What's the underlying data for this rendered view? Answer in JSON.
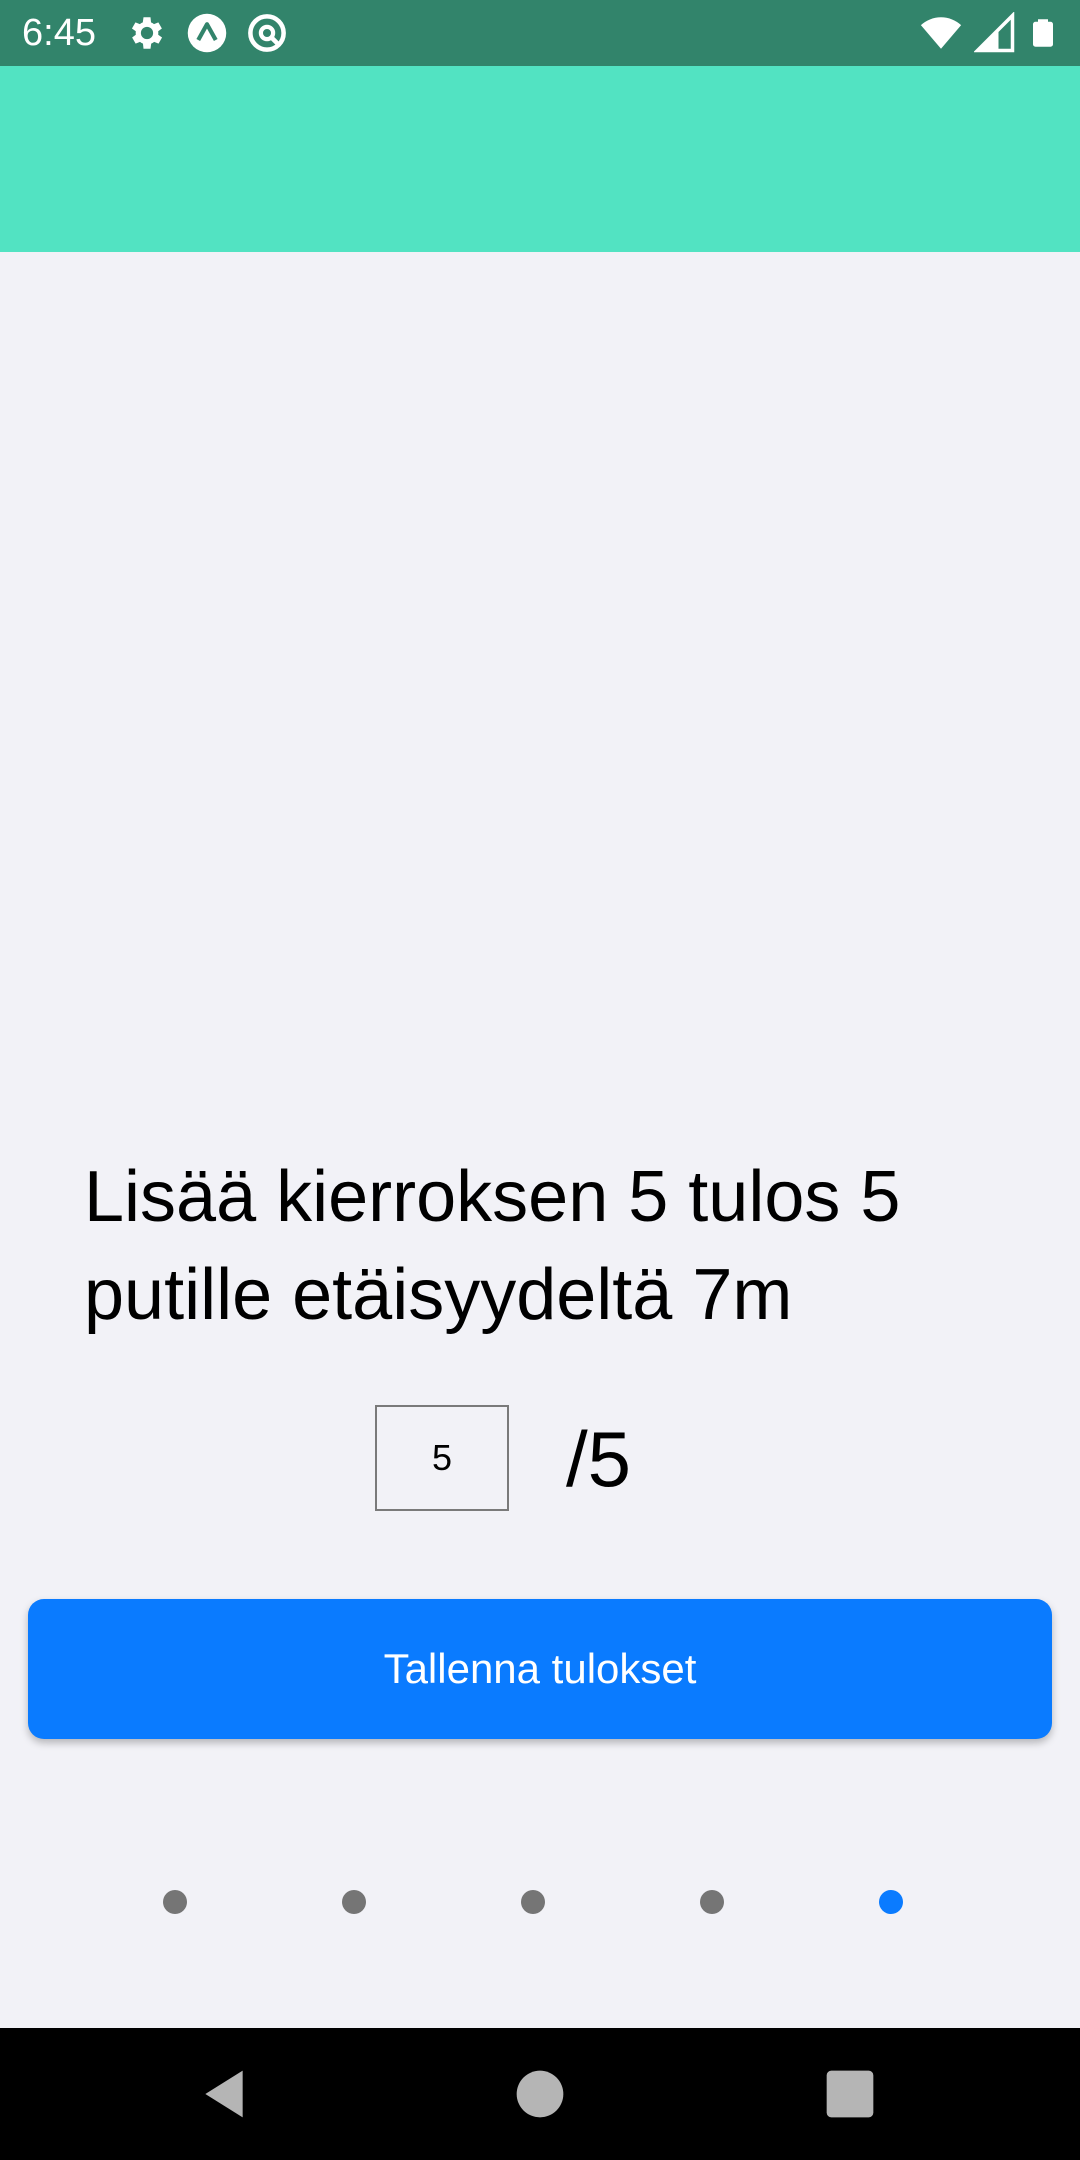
{
  "status_bar": {
    "time": "6:45",
    "left_icons": [
      "gear-icon",
      "expo-icon",
      "at-circle-icon"
    ],
    "right_icons": [
      "wifi-icon",
      "signal-icon",
      "battery-icon"
    ],
    "background": "#32846b"
  },
  "header": {
    "background": "#52e3c2"
  },
  "main": {
    "prompt": "Lisää kierroksen 5 tulos 5 putille etäisyydeltä 7m",
    "score_input_value": "5",
    "score_max": "/5",
    "save_button_label": "Tallenna tulokset",
    "accent_color": "#0a7bff"
  },
  "pagination": {
    "total": 5,
    "current": 5
  },
  "nav_bar": {
    "buttons": [
      "back-icon",
      "home-icon",
      "recents-icon"
    ]
  }
}
